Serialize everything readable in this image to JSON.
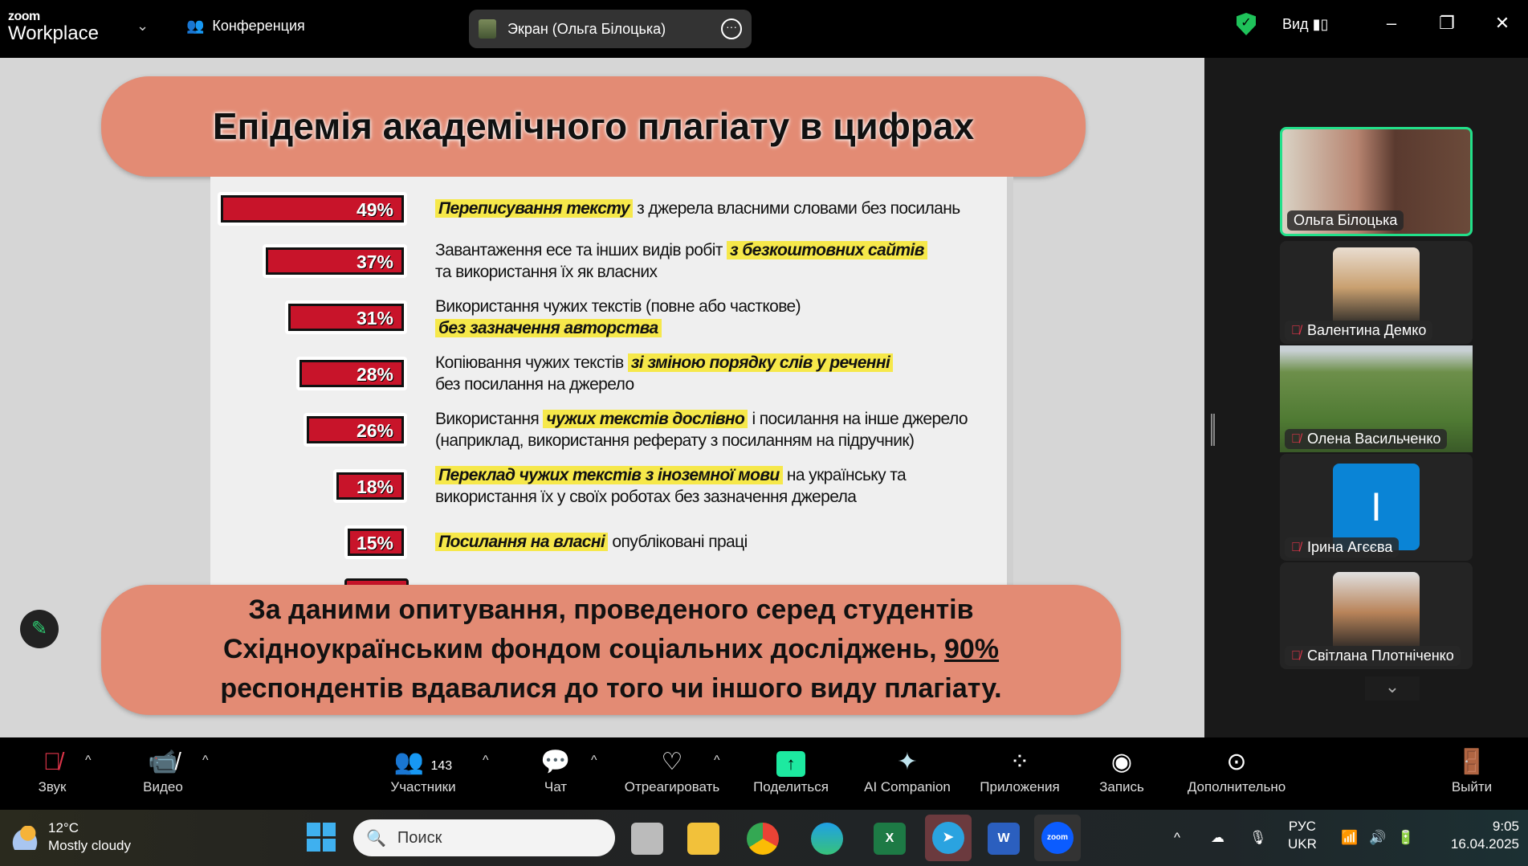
{
  "app": {
    "logo_top": "zoom",
    "logo_bottom": "Workplace",
    "meeting_label": "Конференция",
    "share_pill": "Экран (Ольга Білоцька)",
    "view_label": "Вид"
  },
  "slide": {
    "title": "Епідемія академічного плагіату в цифрах",
    "items": [
      {
        "percent": 49,
        "label": "49%",
        "segments": [
          {
            "t": "Переписування тексту",
            "hl": true
          },
          {
            "t": " з джерела власними словами без посилань",
            "hl": false
          }
        ]
      },
      {
        "percent": 37,
        "label": "37%",
        "segments": [
          {
            "t": "Завантаження есе та інших видів робіт ",
            "hl": false
          },
          {
            "t": "з безкоштовних сайтів",
            "hl": true
          },
          {
            "t": "\nта використання їх як власних",
            "hl": false
          }
        ]
      },
      {
        "percent": 31,
        "label": "31%",
        "segments": [
          {
            "t": "Використання чужих текстів (повне або часткове)\n",
            "hl": false
          },
          {
            "t": "без зазначення авторства",
            "hl": true
          }
        ]
      },
      {
        "percent": 28,
        "label": "28%",
        "segments": [
          {
            "t": "Копіювання чужих текстів ",
            "hl": false
          },
          {
            "t": "зі зміною порядку слів у реченні",
            "hl": true
          },
          {
            "t": "\nбез посилання на джерело",
            "hl": false
          }
        ]
      },
      {
        "percent": 26,
        "label": "26%",
        "segments": [
          {
            "t": "Використання ",
            "hl": false
          },
          {
            "t": "чужих текстів дослівно",
            "hl": true
          },
          {
            "t": " і посилання на інше джерело\n(наприклад, використання реферату з посиланням на підручник)",
            "hl": false
          }
        ]
      },
      {
        "percent": 18,
        "label": "18%",
        "segments": [
          {
            "t": "Переклад чужих текстів з іноземної мови",
            "hl": true
          },
          {
            "t": " на українську та\nвикористання їх у своїх роботах без зазначення джерела",
            "hl": false
          }
        ]
      },
      {
        "percent": 15,
        "label": "15%",
        "segments": [
          {
            "t": "Посилання на власні",
            "hl": true
          },
          {
            "t": " опубліковані праці",
            "hl": false
          }
        ]
      }
    ],
    "bottom_line1": "За даними опитування, проведеного серед студентів",
    "bottom_line2": "Східноукраїнським фондом соціальних досліджень, ",
    "bottom_highlight": "90%",
    "bottom_line3": "респондентів вдавалися до того чи іншого виду плагіату."
  },
  "participants": [
    {
      "name": "Ольга Білоцька",
      "muted": false
    },
    {
      "name": "Валентина Демко",
      "muted": true
    },
    {
      "name": "Олена Васильченко",
      "muted": true
    },
    {
      "name": "Ірина Агєєва",
      "muted": true,
      "initial": "I"
    },
    {
      "name": "Світлана Плотніченко",
      "muted": true
    }
  ],
  "toolbar": {
    "audio": "Звук",
    "video": "Видео",
    "participants": "Участники",
    "participants_count": "143",
    "chat": "Чат",
    "react": "Отреагировать",
    "share": "Поделиться",
    "ai": "AI Companion",
    "apps": "Приложения",
    "record": "Запись",
    "more": "Дополнительно",
    "leave": "Выйти"
  },
  "taskbar": {
    "temp": "12°C",
    "weather": "Mostly cloudy",
    "search_placeholder": "Поиск",
    "lang1": "РУС",
    "lang2": "UKR",
    "time": "9:05",
    "date": "16.04.2025"
  },
  "colors": {
    "accent_green": "#22e08a",
    "bar_red": "#c8142a",
    "highlight": "#f6e84a",
    "pill": "#e38b74",
    "share_green": "#1de9a0"
  }
}
